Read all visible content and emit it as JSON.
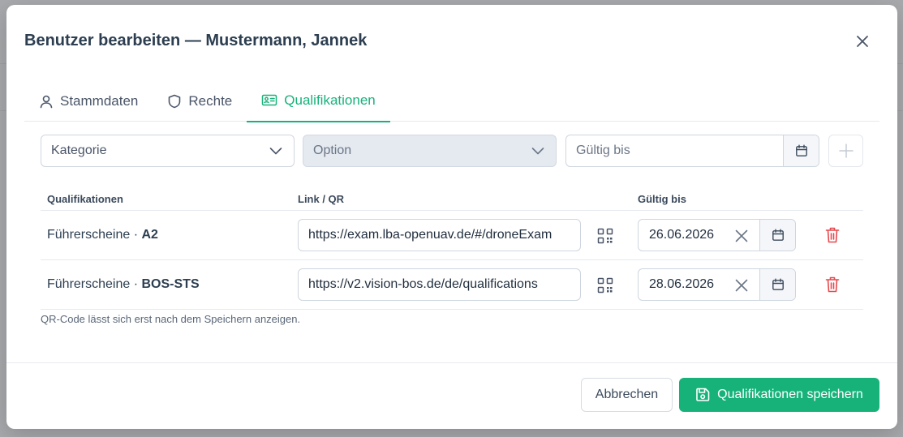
{
  "modal": {
    "title": "Benutzer bearbeiten — Mustermann, Jannek"
  },
  "tabs": [
    {
      "label": "Stammdaten",
      "icon": "user-icon",
      "active": false
    },
    {
      "label": "Rechte",
      "icon": "shield-icon",
      "active": false
    },
    {
      "label": "Qualifikationen",
      "icon": "id-card-icon",
      "active": true
    }
  ],
  "filters": {
    "category_placeholder": "Kategorie",
    "option_placeholder": "Option",
    "valid_until_placeholder": "Gültig bis"
  },
  "table": {
    "headers": [
      "Qualifikationen",
      "Link / QR",
      "Gültig bis"
    ],
    "rows": [
      {
        "category": "Führerscheine · ",
        "option": "A2",
        "link": "https://exam.lba-openuav.de/#/droneExam",
        "valid_until": "26.06.2026"
      },
      {
        "category": "Führerscheine · ",
        "option": "BOS-STS",
        "link": "https://v2.vision-bos.de/de/qualifications",
        "valid_until": "28.06.2026"
      }
    ]
  },
  "hint": "QR-Code lässt sich erst nach dem Speichern anzeigen.",
  "footer": {
    "cancel_label": "Abbrechen",
    "save_label": "Qualifikationen speichern"
  },
  "colors": {
    "accent": "#17b27a",
    "danger": "#e5484d"
  }
}
